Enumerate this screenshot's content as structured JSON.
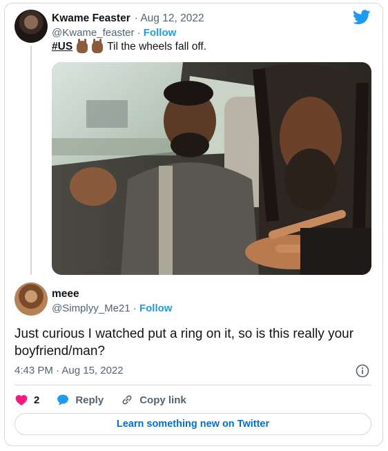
{
  "tweet": {
    "author_name": "Kwame Feaster",
    "date": "· Aug 12, 2022",
    "handle": "@Kwame_feaster",
    "follow_sep": "·",
    "follow": "Follow",
    "hashtag": "#US",
    "text": "Til the wheels fall off.",
    "photo_icon": "photo-of-two-men-in-car"
  },
  "reply": {
    "author_name": "meee",
    "handle": "@Simplyy_Me21",
    "follow_sep": "·",
    "follow": "Follow",
    "text": "Just curious I watched put a ring on it, so is this really your boyfriend/man?",
    "timestamp": "4:43 PM · Aug 15, 2022"
  },
  "actions": {
    "like_count": "2",
    "reply_label": "Reply",
    "copy_link_label": "Copy link"
  },
  "learn_more": "Learn something new on Twitter",
  "colors": {
    "twitter_blue": "#1d9bf0",
    "like_red": "#f91880",
    "secondary_text": "#536471",
    "border": "#cfd9de"
  }
}
